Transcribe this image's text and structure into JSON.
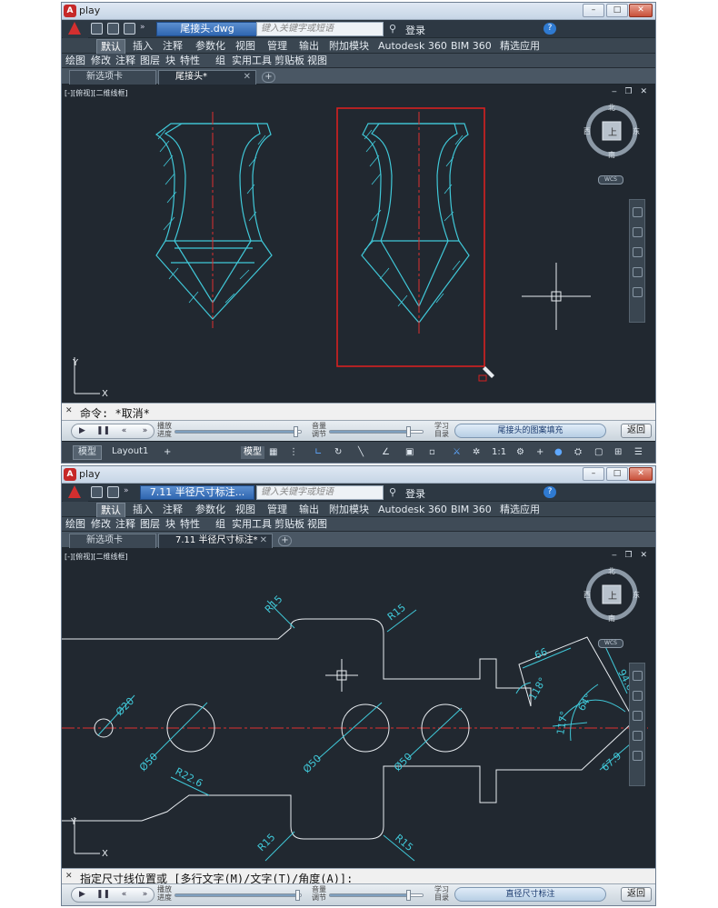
{
  "win1": {
    "title": "play",
    "file_tab": "尾接头.dwg",
    "search_placeholder": "键入关键字或短语",
    "login": "登录",
    "ribbon_tabs": [
      "默认",
      "插入",
      "注释",
      "参数化",
      "视图",
      "管理",
      "输出",
      "附加模块",
      "Autodesk 360",
      "BIM 360",
      "精选应用"
    ],
    "panels": [
      "绘图",
      "修改",
      "注释",
      "图层",
      "块",
      "特性",
      "组",
      "实用工具",
      "剪贴板",
      "视图"
    ],
    "doc_tabs": [
      "新选项卡",
      "尾接头*"
    ],
    "viewport_label": "[-][俯视][二维线框]",
    "viewcube": {
      "top": "上",
      "north": "北",
      "south": "南",
      "east": "东",
      "west": "西",
      "wcs": "WCS"
    },
    "ucs_y": "Y",
    "ucs_x": "X",
    "command": "命令: *取消*",
    "player": {
      "speed_label": "播放进度",
      "volume_label": "音量调节",
      "learn_label": "学习目录",
      "chapter": "尾接头的图案填充",
      "back": "返回"
    },
    "status_tabs": [
      "模型",
      "Layout1"
    ],
    "model_button": "模型",
    "scale": "1:1"
  },
  "win2": {
    "title": "play",
    "file_tab": "7.11 半径尺寸标注...",
    "search_placeholder": "键入关键字或短语",
    "login": "登录",
    "ribbon_tabs": [
      "默认",
      "插入",
      "注释",
      "参数化",
      "视图",
      "管理",
      "输出",
      "附加模块",
      "Autodesk 360",
      "BIM 360",
      "精选应用"
    ],
    "panels": [
      "绘图",
      "修改",
      "注释",
      "图层",
      "块",
      "特性",
      "组",
      "实用工具",
      "剪贴板",
      "视图"
    ],
    "doc_tabs": [
      "新选项卡",
      "7.11 半径尺寸标注*"
    ],
    "viewport_label": "[-][俯视][二维线框]",
    "viewcube": {
      "top": "上",
      "north": "北",
      "south": "南",
      "east": "东",
      "west": "西",
      "wcs": "WCS"
    },
    "ucs_y": "Y",
    "ucs_x": "X",
    "dimensions": [
      "R15",
      "R15",
      "Ø20",
      "Ø50",
      "Ø50",
      "Ø50",
      "R22.6",
      "R15",
      "R15",
      "66",
      "118°",
      "94.6",
      "64°",
      "117°",
      "67.9"
    ],
    "command": "指定尺寸线位置或 [多行文字(M)/文字(T)/角度(A)]:",
    "player": {
      "speed_label": "播放进度",
      "volume_label": "音量调节",
      "learn_label": "学习目录",
      "chapter": "直径尺寸标注",
      "back": "返回"
    }
  },
  "colors": {
    "cad_bg": "#212830",
    "drawing_cyan": "#40c8d8",
    "centerline_red": "#e03030",
    "selection_red": "#d62020",
    "white_line": "#e8ecf0"
  }
}
